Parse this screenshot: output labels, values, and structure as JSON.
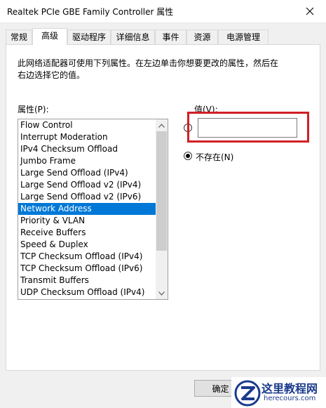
{
  "window": {
    "title": "Realtek PCIe GBE Family Controller 属性"
  },
  "tabs": [
    {
      "label": "常规",
      "active": false
    },
    {
      "label": "高级",
      "active": true
    },
    {
      "label": "驱动程序",
      "active": false
    },
    {
      "label": "详细信息",
      "active": false
    },
    {
      "label": "事件",
      "active": false
    },
    {
      "label": "资源",
      "active": false
    },
    {
      "label": "电源管理",
      "active": false
    }
  ],
  "panel": {
    "description": "此网络适配器可使用下列属性。在左边单击你想要更改的属性，然后在右边选择它的值。",
    "property_label": "属性(P):",
    "value_label": "值(V):",
    "value_input": "",
    "not_present_label": "不存在(N)",
    "selected_radio": "not_present",
    "properties": [
      "Flow Control",
      "Interrupt Moderation",
      "IPv4 Checksum Offload",
      "Jumbo Frame",
      "Large Send Offload (IPv4)",
      "Large Send Offload v2 (IPv4)",
      "Large Send Offload v2 (IPv6)",
      "Network Address",
      "Priority & VLAN",
      "Receive Buffers",
      "Speed & Duplex",
      "TCP Checksum Offload (IPv4)",
      "TCP Checksum Offload (IPv6)",
      "Transmit Buffers",
      "UDP Checksum Offload (IPv4)"
    ],
    "selected_property": "Network Address"
  },
  "footer": {
    "ok_label": "确定"
  },
  "watermark": {
    "title": "这里教程网",
    "url": "herecours.com"
  },
  "colors": {
    "selection": "#0078d7",
    "highlight_box": "#d01f27",
    "watermark": "#1a3a8c"
  }
}
